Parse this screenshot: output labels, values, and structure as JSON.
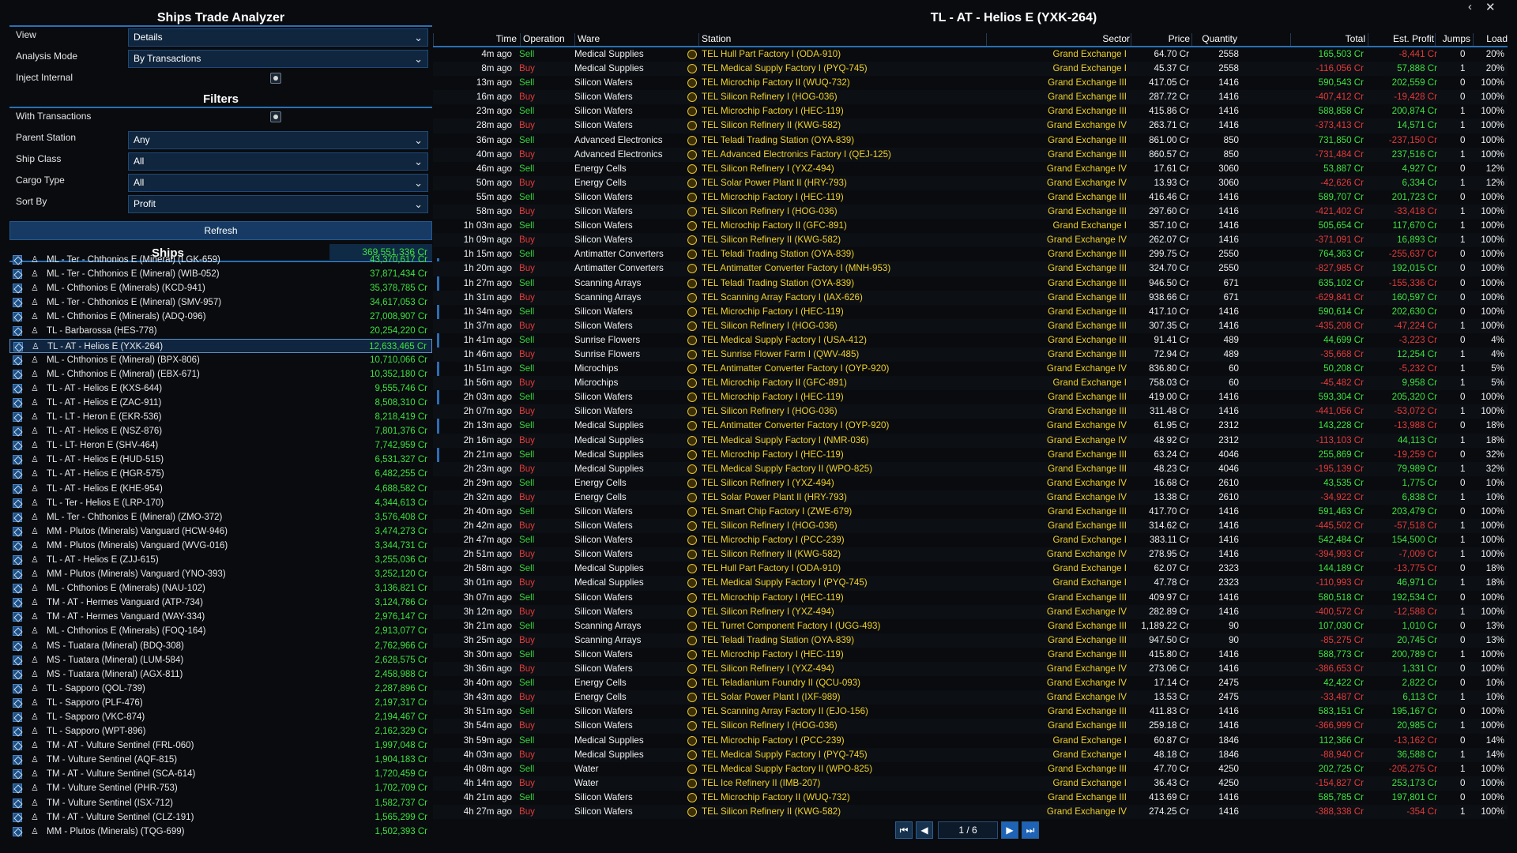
{
  "window": {
    "left_title": "Ships Trade Analyzer",
    "right_title": "TL - AT - Helios E (YXK-264)",
    "page": "1 / 6"
  },
  "settings": {
    "view_label": "View",
    "view_value": "Details",
    "analysis_label": "Analysis Mode",
    "analysis_value": "By Transactions",
    "inject_label": "Inject Internal"
  },
  "filters": {
    "title": "Filters",
    "with_tx": "With Transactions",
    "parent_label": "Parent Station",
    "parent_value": "Any",
    "class_label": "Ship Class",
    "class_value": "All",
    "cargo_label": "Cargo Type",
    "cargo_value": "All",
    "sort_label": "Sort By",
    "sort_value": "Profit",
    "refresh": "Refresh"
  },
  "ships": {
    "title": "Ships",
    "total": "369,551,336 Cr",
    "items": [
      [
        "ML - Ter - Chthonios E (Mineral) (LGK-659)",
        "43,370,617 Cr"
      ],
      [
        "ML - Ter - Chthonios E (Mineral) (WIB-052)",
        "37,871,434 Cr"
      ],
      [
        "ML - Chthonios E (Minerals) (KCD-941)",
        "35,378,785 Cr"
      ],
      [
        "ML - Ter - Chthonios E (Mineral) (SMV-957)",
        "34,617,053 Cr"
      ],
      [
        "ML - Chthonios E (Minerals) (ADQ-096)",
        "27,008,907 Cr"
      ],
      [
        "TL - Barbarossa (HES-778)",
        "20,254,220 Cr"
      ],
      [
        "TL - AT - Helios E (YXK-264)",
        "12,633,465 Cr"
      ],
      [
        "ML - Chthonios E (Mineral) (BPX-806)",
        "10,710,066 Cr"
      ],
      [
        "ML - Chthonios E (Mineral) (EBX-671)",
        "10,352,180 Cr"
      ],
      [
        "TL - AT - Helios E (KXS-644)",
        "9,555,746 Cr"
      ],
      [
        "TL - AT - Helios E (ZAC-911)",
        "8,508,310 Cr"
      ],
      [
        "TL - LT - Heron E (EKR-536)",
        "8,218,419 Cr"
      ],
      [
        "TL - AT - Helios E (NSZ-876)",
        "7,801,376 Cr"
      ],
      [
        "TL - LT- Heron E (SHV-464)",
        "7,742,959 Cr"
      ],
      [
        "TL - AT - Helios E (HUD-515)",
        "6,531,327 Cr"
      ],
      [
        "TL - AT - Helios E (HGR-575)",
        "6,482,255 Cr"
      ],
      [
        "TL - AT - Helios E (KHE-954)",
        "4,688,582 Cr"
      ],
      [
        "TL - Ter - Helios E (LRP-170)",
        "4,344,613 Cr"
      ],
      [
        "ML - Ter - Chthonios E (Mineral) (ZMO-372)",
        "3,576,408 Cr"
      ],
      [
        "MM - Plutos (Minerals) Vanguard (HCW-946)",
        "3,474,273 Cr"
      ],
      [
        "MM - Plutos (Minerals) Vanguard (WVG-016)",
        "3,344,731 Cr"
      ],
      [
        "TL - AT - Helios E (ZJJ-615)",
        "3,255,036 Cr"
      ],
      [
        "MM - Plutos (Minerals) Vanguard (YNO-393)",
        "3,252,120 Cr"
      ],
      [
        "ML - Chthonios E (Minerals) (NAU-102)",
        "3,136,821 Cr"
      ],
      [
        "TM - AT - Hermes Vanguard (ATP-734)",
        "3,124,786 Cr"
      ],
      [
        "TM - AT - Hermes Vanguard (WAY-334)",
        "2,976,147 Cr"
      ],
      [
        "ML - Chthonios E (Minerals) (FOQ-164)",
        "2,913,077 Cr"
      ],
      [
        "MS - Tuatara (Mineral) (BDQ-308)",
        "2,762,966 Cr"
      ],
      [
        "MS - Tuatara (Mineral) (LUM-584)",
        "2,628,575 Cr"
      ],
      [
        "MS - Tuatara (Mineral) (AGX-811)",
        "2,458,988 Cr"
      ],
      [
        "TL - Sapporo (QOL-739)",
        "2,287,896 Cr"
      ],
      [
        "TL - Sapporo (PLF-476)",
        "2,197,317 Cr"
      ],
      [
        "TL - Sapporo (VKC-874)",
        "2,194,467 Cr"
      ],
      [
        "TL - Sapporo (WPT-896)",
        "2,162,329 Cr"
      ],
      [
        "TM - AT - Vulture Sentinel (FRL-060)",
        "1,997,048 Cr"
      ],
      [
        "TM - Vulture Sentinel (AQF-815)",
        "1,904,183 Cr"
      ],
      [
        "TM - AT - Vulture Sentinel (SCA-614)",
        "1,720,459 Cr"
      ],
      [
        "TM - Vulture Sentinel (PHR-753)",
        "1,702,709 Cr"
      ],
      [
        "TM - Vulture Sentinel (ISX-712)",
        "1,582,737 Cr"
      ],
      [
        "TM - AT - Vulture Sentinel (CLZ-191)",
        "1,565,299 Cr"
      ],
      [
        "MM - Plutos (Minerals) (TQG-699)",
        "1,502,393 Cr"
      ]
    ]
  },
  "table": {
    "headers": [
      "Time",
      "Operation",
      "Ware",
      "Station",
      "Sector",
      "Price",
      "Quantity",
      "Total",
      "Est. Profit",
      "Jumps",
      "Load"
    ],
    "rows": [
      [
        "4m ago",
        "Sell",
        "Medical Supplies",
        "TEL Hull Part Factory I (ODA-910)",
        "Grand Exchange I",
        "64.70 Cr",
        "2558",
        "165,503 Cr",
        "-8,441 Cr",
        "0",
        "20%"
      ],
      [
        "8m ago",
        "Buy",
        "Medical Supplies",
        "TEL Medical Supply Factory I (PYQ-745)",
        "Grand Exchange I",
        "45.37 Cr",
        "2558",
        "-116,056 Cr",
        "57,888 Cr",
        "1",
        "20%"
      ],
      [
        "13m ago",
        "Sell",
        "Silicon Wafers",
        "TEL Microchip Factory II (WUQ-732)",
        "Grand Exchange III",
        "417.05 Cr",
        "1416",
        "590,543 Cr",
        "202,559 Cr",
        "0",
        "100%"
      ],
      [
        "16m ago",
        "Buy",
        "Silicon Wafers",
        "TEL Silicon Refinery I (HOG-036)",
        "Grand Exchange III",
        "287.72 Cr",
        "1416",
        "-407,412 Cr",
        "-19,428 Cr",
        "0",
        "100%"
      ],
      [
        "23m ago",
        "Sell",
        "Silicon Wafers",
        "TEL Microchip Factory I (HEC-119)",
        "Grand Exchange III",
        "415.86 Cr",
        "1416",
        "588,858 Cr",
        "200,874 Cr",
        "1",
        "100%"
      ],
      [
        "28m ago",
        "Buy",
        "Silicon Wafers",
        "TEL Silicon Refinery II (KWG-582)",
        "Grand Exchange IV",
        "263.71 Cr",
        "1416",
        "-373,413 Cr",
        "14,571 Cr",
        "1",
        "100%"
      ],
      [
        "36m ago",
        "Sell",
        "Advanced Electronics",
        "TEL Teladi Trading Station (OYA-839)",
        "Grand Exchange III",
        "861.00 Cr",
        "850",
        "731,850 Cr",
        "-237,150 Cr",
        "0",
        "100%"
      ],
      [
        "40m ago",
        "Buy",
        "Advanced Electronics",
        "TEL Advanced Electronics Factory I (QEJ-125)",
        "Grand Exchange III",
        "860.57 Cr",
        "850",
        "-731,484 Cr",
        "237,516 Cr",
        "1",
        "100%"
      ],
      [
        "46m ago",
        "Sell",
        "Energy Cells",
        "TEL Silicon Refinery I (YXZ-494)",
        "Grand Exchange IV",
        "17.61 Cr",
        "3060",
        "53,887 Cr",
        "4,927 Cr",
        "0",
        "12%"
      ],
      [
        "50m ago",
        "Buy",
        "Energy Cells",
        "TEL Solar Power Plant II (HRY-793)",
        "Grand Exchange IV",
        "13.93 Cr",
        "3060",
        "-42,626 Cr",
        "6,334 Cr",
        "1",
        "12%"
      ],
      [
        "55m ago",
        "Sell",
        "Silicon Wafers",
        "TEL Microchip Factory I (HEC-119)",
        "Grand Exchange III",
        "416.46 Cr",
        "1416",
        "589,707 Cr",
        "201,723 Cr",
        "0",
        "100%"
      ],
      [
        "58m ago",
        "Buy",
        "Silicon Wafers",
        "TEL Silicon Refinery I (HOG-036)",
        "Grand Exchange III",
        "297.60 Cr",
        "1416",
        "-421,402 Cr",
        "-33,418 Cr",
        "1",
        "100%"
      ],
      [
        "1h 03m ago",
        "Sell",
        "Silicon Wafers",
        "TEL Microchip Factory II (GFC-891)",
        "Grand Exchange I",
        "357.10 Cr",
        "1416",
        "505,654 Cr",
        "117,670 Cr",
        "1",
        "100%"
      ],
      [
        "1h 09m ago",
        "Buy",
        "Silicon Wafers",
        "TEL Silicon Refinery II (KWG-582)",
        "Grand Exchange IV",
        "262.07 Cr",
        "1416",
        "-371,091 Cr",
        "16,893 Cr",
        "1",
        "100%"
      ],
      [
        "1h 15m ago",
        "Sell",
        "Antimatter Converters",
        "TEL Teladi Trading Station (OYA-839)",
        "Grand Exchange III",
        "299.75 Cr",
        "2550",
        "764,363 Cr",
        "-255,637 Cr",
        "0",
        "100%"
      ],
      [
        "1h 20m ago",
        "Buy",
        "Antimatter Converters",
        "TEL Antimatter Converter Factory I (MNH-953)",
        "Grand Exchange III",
        "324.70 Cr",
        "2550",
        "-827,985 Cr",
        "192,015 Cr",
        "0",
        "100%"
      ],
      [
        "1h 27m ago",
        "Sell",
        "Scanning Arrays",
        "TEL Teladi Trading Station (OYA-839)",
        "Grand Exchange III",
        "946.50 Cr",
        "671",
        "635,102 Cr",
        "-155,336 Cr",
        "0",
        "100%"
      ],
      [
        "1h 31m ago",
        "Buy",
        "Scanning Arrays",
        "TEL Scanning Array Factory I (IAX-626)",
        "Grand Exchange III",
        "938.66 Cr",
        "671",
        "-629,841 Cr",
        "160,597 Cr",
        "0",
        "100%"
      ],
      [
        "1h 34m ago",
        "Sell",
        "Silicon Wafers",
        "TEL Microchip Factory I (HEC-119)",
        "Grand Exchange III",
        "417.10 Cr",
        "1416",
        "590,614 Cr",
        "202,630 Cr",
        "0",
        "100%"
      ],
      [
        "1h 37m ago",
        "Buy",
        "Silicon Wafers",
        "TEL Silicon Refinery I (HOG-036)",
        "Grand Exchange III",
        "307.35 Cr",
        "1416",
        "-435,208 Cr",
        "-47,224 Cr",
        "1",
        "100%"
      ],
      [
        "1h 41m ago",
        "Sell",
        "Sunrise Flowers",
        "TEL Medical Supply Factory I (USA-412)",
        "Grand Exchange III",
        "91.41 Cr",
        "489",
        "44,699 Cr",
        "-3,223 Cr",
        "0",
        "4%"
      ],
      [
        "1h 46m ago",
        "Buy",
        "Sunrise Flowers",
        "TEL Sunrise Flower Farm I (QWV-485)",
        "Grand Exchange III",
        "72.94 Cr",
        "489",
        "-35,668 Cr",
        "12,254 Cr",
        "1",
        "4%"
      ],
      [
        "1h 51m ago",
        "Sell",
        "Microchips",
        "TEL Antimatter Converter Factory I (OYP-920)",
        "Grand Exchange IV",
        "836.80 Cr",
        "60",
        "50,208 Cr",
        "-5,232 Cr",
        "1",
        "5%"
      ],
      [
        "1h 56m ago",
        "Buy",
        "Microchips",
        "TEL Microchip Factory II (GFC-891)",
        "Grand Exchange I",
        "758.03 Cr",
        "60",
        "-45,482 Cr",
        "9,958 Cr",
        "1",
        "5%"
      ],
      [
        "2h 03m ago",
        "Sell",
        "Silicon Wafers",
        "TEL Microchip Factory I (HEC-119)",
        "Grand Exchange III",
        "419.00 Cr",
        "1416",
        "593,304 Cr",
        "205,320 Cr",
        "0",
        "100%"
      ],
      [
        "2h 07m ago",
        "Buy",
        "Silicon Wafers",
        "TEL Silicon Refinery I (HOG-036)",
        "Grand Exchange III",
        "311.48 Cr",
        "1416",
        "-441,056 Cr",
        "-53,072 Cr",
        "1",
        "100%"
      ],
      [
        "2h 13m ago",
        "Sell",
        "Medical Supplies",
        "TEL Antimatter Converter Factory I (OYP-920)",
        "Grand Exchange IV",
        "61.95 Cr",
        "2312",
        "143,228 Cr",
        "-13,988 Cr",
        "0",
        "18%"
      ],
      [
        "2h 16m ago",
        "Buy",
        "Medical Supplies",
        "TEL Medical Supply Factory I (NMR-036)",
        "Grand Exchange IV",
        "48.92 Cr",
        "2312",
        "-113,103 Cr",
        "44,113 Cr",
        "1",
        "18%"
      ],
      [
        "2h 21m ago",
        "Sell",
        "Medical Supplies",
        "TEL Microchip Factory I (HEC-119)",
        "Grand Exchange III",
        "63.24 Cr",
        "4046",
        "255,869 Cr",
        "-19,259 Cr",
        "0",
        "32%"
      ],
      [
        "2h 23m ago",
        "Buy",
        "Medical Supplies",
        "TEL Medical Supply Factory II (WPO-825)",
        "Grand Exchange III",
        "48.23 Cr",
        "4046",
        "-195,139 Cr",
        "79,989 Cr",
        "1",
        "32%"
      ],
      [
        "2h 29m ago",
        "Sell",
        "Energy Cells",
        "TEL Silicon Refinery I (YXZ-494)",
        "Grand Exchange IV",
        "16.68 Cr",
        "2610",
        "43,535 Cr",
        "1,775 Cr",
        "0",
        "10%"
      ],
      [
        "2h 32m ago",
        "Buy",
        "Energy Cells",
        "TEL Solar Power Plant II (HRY-793)",
        "Grand Exchange IV",
        "13.38 Cr",
        "2610",
        "-34,922 Cr",
        "6,838 Cr",
        "1",
        "10%"
      ],
      [
        "2h 40m ago",
        "Sell",
        "Silicon Wafers",
        "TEL Smart Chip Factory I (ZWE-679)",
        "Grand Exchange III",
        "417.70 Cr",
        "1416",
        "591,463 Cr",
        "203,479 Cr",
        "0",
        "100%"
      ],
      [
        "2h 42m ago",
        "Buy",
        "Silicon Wafers",
        "TEL Silicon Refinery I (HOG-036)",
        "Grand Exchange III",
        "314.62 Cr",
        "1416",
        "-445,502 Cr",
        "-57,518 Cr",
        "1",
        "100%"
      ],
      [
        "2h 47m ago",
        "Sell",
        "Silicon Wafers",
        "TEL Microchip Factory I (PCC-239)",
        "Grand Exchange I",
        "383.11 Cr",
        "1416",
        "542,484 Cr",
        "154,500 Cr",
        "1",
        "100%"
      ],
      [
        "2h 51m ago",
        "Buy",
        "Silicon Wafers",
        "TEL Silicon Refinery II (KWG-582)",
        "Grand Exchange IV",
        "278.95 Cr",
        "1416",
        "-394,993 Cr",
        "-7,009 Cr",
        "1",
        "100%"
      ],
      [
        "2h 58m ago",
        "Sell",
        "Medical Supplies",
        "TEL Hull Part Factory I (ODA-910)",
        "Grand Exchange I",
        "62.07 Cr",
        "2323",
        "144,189 Cr",
        "-13,775 Cr",
        "0",
        "18%"
      ],
      [
        "3h 01m ago",
        "Buy",
        "Medical Supplies",
        "TEL Medical Supply Factory I (PYQ-745)",
        "Grand Exchange I",
        "47.78 Cr",
        "2323",
        "-110,993 Cr",
        "46,971 Cr",
        "1",
        "18%"
      ],
      [
        "3h 07m ago",
        "Sell",
        "Silicon Wafers",
        "TEL Microchip Factory I (HEC-119)",
        "Grand Exchange III",
        "409.97 Cr",
        "1416",
        "580,518 Cr",
        "192,534 Cr",
        "0",
        "100%"
      ],
      [
        "3h 12m ago",
        "Buy",
        "Silicon Wafers",
        "TEL Silicon Refinery I (YXZ-494)",
        "Grand Exchange IV",
        "282.89 Cr",
        "1416",
        "-400,572 Cr",
        "-12,588 Cr",
        "1",
        "100%"
      ],
      [
        "3h 21m ago",
        "Sell",
        "Scanning Arrays",
        "TEL Turret Component Factory I (UGG-493)",
        "Grand Exchange III",
        "1,189.22 Cr",
        "90",
        "107,030 Cr",
        "1,010 Cr",
        "0",
        "13%"
      ],
      [
        "3h 25m ago",
        "Buy",
        "Scanning Arrays",
        "TEL Teladi Trading Station (OYA-839)",
        "Grand Exchange III",
        "947.50 Cr",
        "90",
        "-85,275 Cr",
        "20,745 Cr",
        "0",
        "13%"
      ],
      [
        "3h 30m ago",
        "Sell",
        "Silicon Wafers",
        "TEL Microchip Factory I (HEC-119)",
        "Grand Exchange III",
        "415.80 Cr",
        "1416",
        "588,773 Cr",
        "200,789 Cr",
        "1",
        "100%"
      ],
      [
        "3h 36m ago",
        "Buy",
        "Silicon Wafers",
        "TEL Silicon Refinery I (YXZ-494)",
        "Grand Exchange IV",
        "273.06 Cr",
        "1416",
        "-386,653 Cr",
        "1,331 Cr",
        "0",
        "100%"
      ],
      [
        "3h 40m ago",
        "Sell",
        "Energy Cells",
        "TEL Teladianium Foundry II (QCU-093)",
        "Grand Exchange IV",
        "17.14 Cr",
        "2475",
        "42,422 Cr",
        "2,822 Cr",
        "0",
        "10%"
      ],
      [
        "3h 43m ago",
        "Buy",
        "Energy Cells",
        "TEL Solar Power Plant I (IXF-989)",
        "Grand Exchange IV",
        "13.53 Cr",
        "2475",
        "-33,487 Cr",
        "6,113 Cr",
        "1",
        "10%"
      ],
      [
        "3h 51m ago",
        "Sell",
        "Silicon Wafers",
        "TEL Scanning Array Factory II (EJO-156)",
        "Grand Exchange III",
        "411.83 Cr",
        "1416",
        "583,151 Cr",
        "195,167 Cr",
        "0",
        "100%"
      ],
      [
        "3h 54m ago",
        "Buy",
        "Silicon Wafers",
        "TEL Silicon Refinery I (HOG-036)",
        "Grand Exchange III",
        "259.18 Cr",
        "1416",
        "-366,999 Cr",
        "20,985 Cr",
        "1",
        "100%"
      ],
      [
        "3h 59m ago",
        "Sell",
        "Medical Supplies",
        "TEL Microchip Factory I (PCC-239)",
        "Grand Exchange I",
        "60.87 Cr",
        "1846",
        "112,366 Cr",
        "-13,162 Cr",
        "0",
        "14%"
      ],
      [
        "4h 03m ago",
        "Buy",
        "Medical Supplies",
        "TEL Medical Supply Factory I (PYQ-745)",
        "Grand Exchange I",
        "48.18 Cr",
        "1846",
        "-88,940 Cr",
        "36,588 Cr",
        "1",
        "14%"
      ],
      [
        "4h 08m ago",
        "Sell",
        "Water",
        "TEL Medical Supply Factory II (WPO-825)",
        "Grand Exchange III",
        "47.70 Cr",
        "4250",
        "202,725 Cr",
        "-205,275 Cr",
        "1",
        "100%"
      ],
      [
        "4h 14m ago",
        "Buy",
        "Water",
        "TEL Ice Refinery II (IMB-207)",
        "Grand Exchange I",
        "36.43 Cr",
        "4250",
        "-154,827 Cr",
        "253,173 Cr",
        "0",
        "100%"
      ],
      [
        "4h 21m ago",
        "Sell",
        "Silicon Wafers",
        "TEL Microchip Factory II (WUQ-732)",
        "Grand Exchange III",
        "413.69 Cr",
        "1416",
        "585,785 Cr",
        "197,801 Cr",
        "0",
        "100%"
      ],
      [
        "4h 27m ago",
        "Buy",
        "Silicon Wafers",
        "TEL Silicon Refinery II (KWG-582)",
        "Grand Exchange IV",
        "274.25 Cr",
        "1416",
        "-388,338 Cr",
        "-354 Cr",
        "1",
        "100%"
      ]
    ]
  }
}
